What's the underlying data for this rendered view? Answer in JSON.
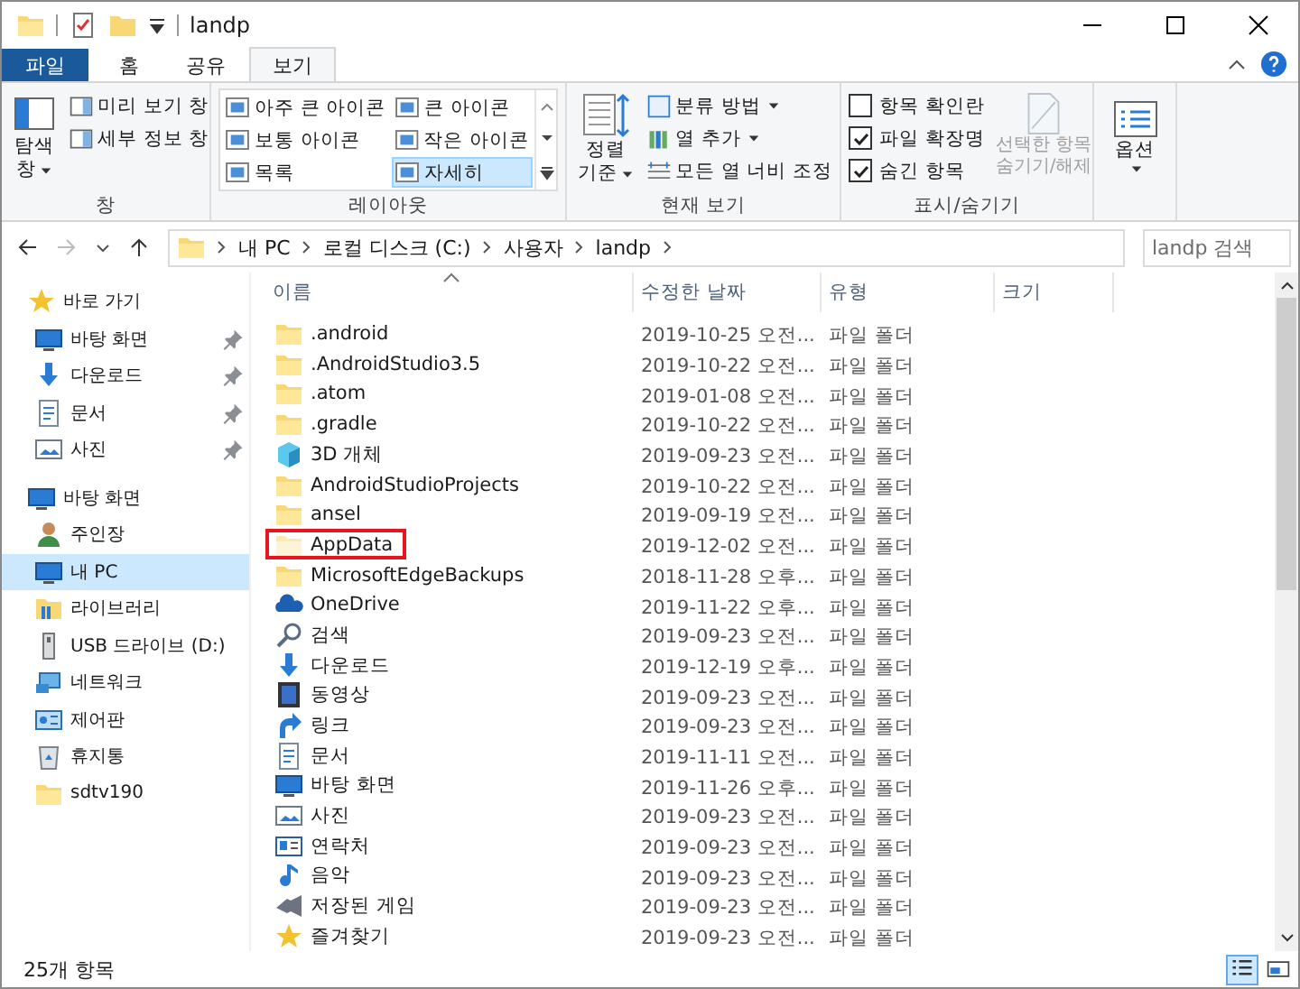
{
  "window": {
    "title": "landp"
  },
  "ribbon_tabs": [
    {
      "label": "파일",
      "kind": "file",
      "selected": false
    },
    {
      "label": "홈",
      "kind": "tab",
      "selected": false
    },
    {
      "label": "공유",
      "kind": "tab",
      "selected": false
    },
    {
      "label": "보기",
      "kind": "tab",
      "selected": true
    }
  ],
  "ribbon": {
    "pane_group": {
      "label": "창",
      "navigation_pane": "탐색\n창",
      "preview_pane": "미리 보기 창",
      "details_pane": "세부 정보 창"
    },
    "layout_group": {
      "label": "레이아웃",
      "options": [
        {
          "label": "아주 큰 아이콘",
          "selected": false
        },
        {
          "label": "큰 아이콘",
          "selected": false
        },
        {
          "label": "보통 아이콘",
          "selected": false
        },
        {
          "label": "작은 아이콘",
          "selected": false
        },
        {
          "label": "목록",
          "selected": false
        },
        {
          "label": "자세히",
          "selected": true
        }
      ]
    },
    "current_view_group": {
      "label": "현재 보기",
      "sort_by": "정렬\n기준",
      "group_by": "분류 방법",
      "add_columns": "열 추가",
      "size_all_columns": "모든 열 너비 조정"
    },
    "show_hide_group": {
      "label": "표시/숨기기",
      "checkboxes": [
        {
          "label": "항목 확인란",
          "checked": false
        },
        {
          "label": "파일 확장명",
          "checked": true
        },
        {
          "label": "숨긴 항목",
          "checked": true
        }
      ],
      "hide_selected": {
        "label": "선택한 항목\n숨기기/해제",
        "disabled": true
      }
    },
    "options": {
      "label": "옵션"
    }
  },
  "address_bar": {
    "crumbs": [
      "내 PC",
      "로컬 디스크 (C:)",
      "사용자",
      "landp"
    ]
  },
  "search": {
    "placeholder": "landp 검색"
  },
  "sidebar": {
    "items": [
      {
        "label": "바로 가기",
        "kind": "star",
        "selected": false,
        "children": [
          {
            "label": "바탕 화면",
            "kind": "desktop",
            "pinned": true,
            "selected": false
          },
          {
            "label": "다운로드",
            "kind": "download",
            "pinned": true,
            "selected": false
          },
          {
            "label": "문서",
            "kind": "document",
            "pinned": true,
            "selected": false
          },
          {
            "label": "사진",
            "kind": "photo",
            "pinned": true,
            "selected": false
          }
        ]
      },
      {
        "label": "바탕 화면",
        "kind": "desktop",
        "selected": false,
        "children": [
          {
            "label": "주인장",
            "kind": "person",
            "pinned": false,
            "selected": false
          },
          {
            "label": "내 PC",
            "kind": "desktop",
            "pinned": false,
            "selected": true
          },
          {
            "label": "라이브러리",
            "kind": "library",
            "pinned": false,
            "selected": false
          },
          {
            "label": "USB 드라이브 (D:)",
            "kind": "usb",
            "pinned": false,
            "selected": false
          },
          {
            "label": "네트워크",
            "kind": "network",
            "pinned": false,
            "selected": false
          },
          {
            "label": "제어판",
            "kind": "control",
            "pinned": false,
            "selected": false
          },
          {
            "label": "휴지통",
            "kind": "trash",
            "pinned": false,
            "selected": false
          },
          {
            "label": "sdtv190",
            "kind": "folder",
            "pinned": false,
            "selected": false
          }
        ]
      }
    ]
  },
  "table": {
    "columns": [
      "이름",
      "수정한 날짜",
      "유형",
      "크기"
    ],
    "rows": [
      {
        "name": ".android",
        "date": "2019-10-25 오전...",
        "type": "파일 폴더",
        "kind": "folder",
        "highlighted": false
      },
      {
        "name": ".AndroidStudio3.5",
        "date": "2019-10-22 오전...",
        "type": "파일 폴더",
        "kind": "folder",
        "highlighted": false
      },
      {
        "name": ".atom",
        "date": "2019-01-08 오전...",
        "type": "파일 폴더",
        "kind": "folder",
        "highlighted": false
      },
      {
        "name": ".gradle",
        "date": "2019-10-22 오전...",
        "type": "파일 폴더",
        "kind": "folder",
        "highlighted": false
      },
      {
        "name": "3D 개체",
        "date": "2019-09-23 오전...",
        "type": "파일 폴더",
        "kind": "cube",
        "highlighted": false
      },
      {
        "name": "AndroidStudioProjects",
        "date": "2019-10-22 오전...",
        "type": "파일 폴더",
        "kind": "folder",
        "highlighted": false
      },
      {
        "name": "ansel",
        "date": "2019-09-19 오전...",
        "type": "파일 폴더",
        "kind": "folder",
        "highlighted": false
      },
      {
        "name": "AppData",
        "date": "2019-12-02 오전...",
        "type": "파일 폴더",
        "kind": "hidden_folder",
        "highlighted": true
      },
      {
        "name": "MicrosoftEdgeBackups",
        "date": "2018-11-28 오후...",
        "type": "파일 폴더",
        "kind": "folder",
        "highlighted": false
      },
      {
        "name": "OneDrive",
        "date": "2019-11-22 오후...",
        "type": "파일 폴더",
        "kind": "cloud",
        "highlighted": false
      },
      {
        "name": "검색",
        "date": "2019-09-23 오전...",
        "type": "파일 폴더",
        "kind": "search",
        "highlighted": false
      },
      {
        "name": "다운로드",
        "date": "2019-12-19 오후...",
        "type": "파일 폴더",
        "kind": "download",
        "highlighted": false
      },
      {
        "name": "동영상",
        "date": "2019-09-23 오전...",
        "type": "파일 폴더",
        "kind": "video",
        "highlighted": false
      },
      {
        "name": "링크",
        "date": "2019-09-23 오전...",
        "type": "파일 폴더",
        "kind": "link",
        "highlighted": false
      },
      {
        "name": "문서",
        "date": "2019-11-11 오전...",
        "type": "파일 폴더",
        "kind": "document",
        "highlighted": false
      },
      {
        "name": "바탕 화면",
        "date": "2019-11-26 오후...",
        "type": "파일 폴더",
        "kind": "desktop",
        "highlighted": false
      },
      {
        "name": "사진",
        "date": "2019-09-23 오전...",
        "type": "파일 폴더",
        "kind": "photo",
        "highlighted": false
      },
      {
        "name": "연락처",
        "date": "2019-09-23 오전...",
        "type": "파일 폴더",
        "kind": "contact",
        "highlighted": false
      },
      {
        "name": "음악",
        "date": "2019-09-23 오전...",
        "type": "파일 폴더",
        "kind": "music",
        "highlighted": false
      },
      {
        "name": "저장된 게임",
        "date": "2019-09-23 오전...",
        "type": "파일 폴더",
        "kind": "game",
        "highlighted": false
      },
      {
        "name": "즐겨찾기",
        "date": "2019-09-23 오전...",
        "type": "파일 폴더",
        "kind": "star",
        "highlighted": false
      }
    ]
  },
  "status_bar": {
    "item_count": "25개 항목",
    "view_buttons": [
      {
        "kind": "details",
        "selected": true
      },
      {
        "kind": "thumbnails",
        "selected": false
      }
    ]
  }
}
